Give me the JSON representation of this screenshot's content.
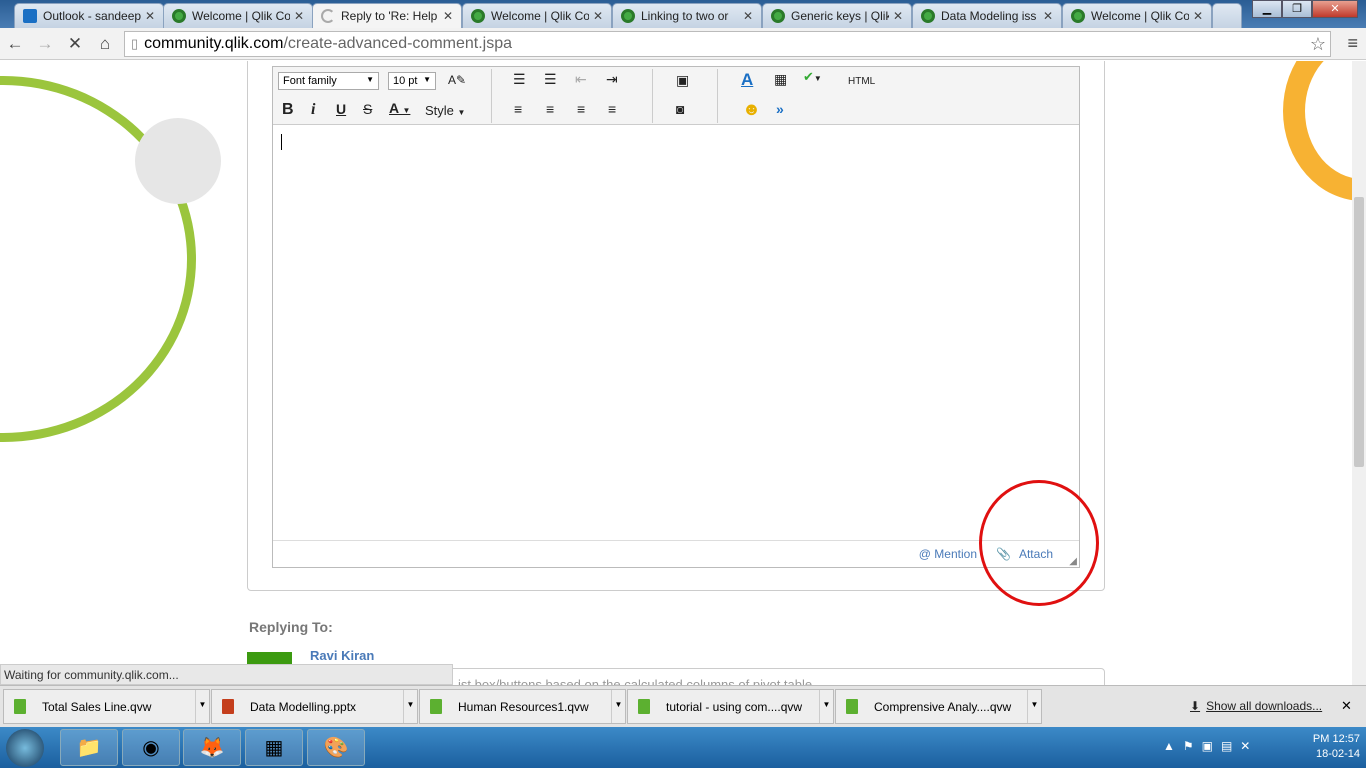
{
  "browser": {
    "tabs": [
      {
        "title": "Outlook - sandeep",
        "icon": "outlook-icon"
      },
      {
        "title": "Welcome | Qlik Co",
        "icon": "qlik-icon"
      },
      {
        "title": "Reply to 'Re: Help",
        "icon": "loading-spinner-icon",
        "active": true
      },
      {
        "title": "Welcome | Qlik Co",
        "icon": "qlik-icon"
      },
      {
        "title": "Linking to two or",
        "icon": "qlik-icon"
      },
      {
        "title": "Generic keys | Qlik",
        "icon": "qlik-icon"
      },
      {
        "title": "Data Modeling iss",
        "icon": "qlik-icon"
      },
      {
        "title": "Welcome | Qlik Co",
        "icon": "qlik-icon"
      }
    ],
    "url_host": "community.qlik.com",
    "url_path": "/create-advanced-comment.jspa",
    "status": "Waiting for community.qlik.com..."
  },
  "editor": {
    "font_family": "Font family",
    "font_size": "10 pt",
    "style_label": "Style",
    "html_label": "HTML",
    "mention_label": "@ Mention",
    "attach_label": "Attach"
  },
  "replying": {
    "label": "Replying To:",
    "author": "Ravi Kiran",
    "snippet": "ist box/buttons based on the calculated columns of pivot table"
  },
  "downloads": {
    "items": [
      {
        "name": "Total Sales Line.qvw",
        "type": "qvw"
      },
      {
        "name": "Data Modelling.pptx",
        "type": "pptx"
      },
      {
        "name": "Human Resources1.qvw",
        "type": "qvw"
      },
      {
        "name": "tutorial - using com....qvw",
        "type": "qvw"
      },
      {
        "name": "Comprensive Analy....qvw",
        "type": "qvw"
      }
    ],
    "show_all": "Show all downloads..."
  },
  "taskbar": {
    "time": "PM 12:57",
    "date": "18-02-14"
  }
}
